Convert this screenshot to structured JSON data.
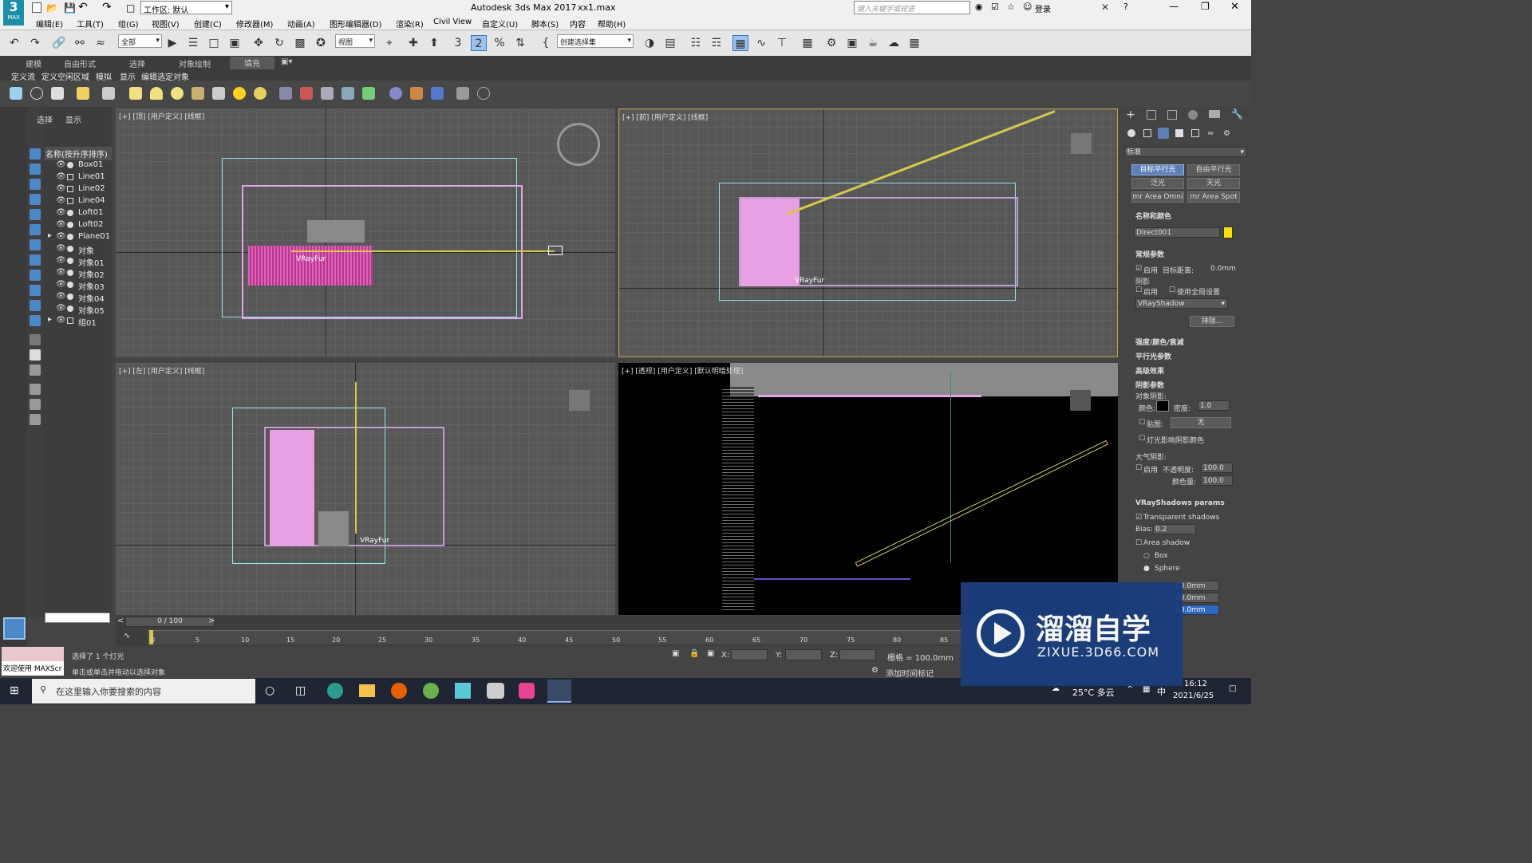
{
  "app": {
    "logo_text": "MAX",
    "logo_num": "3",
    "title": "Autodesk 3ds Max 2017",
    "file": "xx1.max",
    "workspace": "工作区: 默认",
    "search_placeholder": "键入关键字或短语",
    "login": "登录"
  },
  "menu": [
    "编辑(E)",
    "工具(T)",
    "组(G)",
    "视图(V)",
    "创建(C)",
    "修改器(M)",
    "动画(A)",
    "图形编辑器(D)",
    "渲染(R)",
    "Civil View",
    "自定义(U)",
    "脚本(S)",
    "内容",
    "帮助(H)"
  ],
  "toolbar": {
    "filter": "全部",
    "view": "视图",
    "selset": "创建选择集",
    "num3": "3",
    "num2": "2"
  },
  "ribbon_tabs": [
    "建模",
    "自由形式",
    "选择",
    "对象绘制",
    "填充"
  ],
  "ribbon_sub": [
    "定义流",
    "定义空闲区域",
    "模拟",
    "显示",
    "编辑选定对象"
  ],
  "scene_explorer": {
    "tabs": [
      "选择",
      "显示"
    ],
    "header": "名称(按升序排序)",
    "items": [
      "Box01",
      "Line01",
      "Line02",
      "Line04",
      "Loft01",
      "Loft02",
      "Plane01",
      "对象",
      "对象01",
      "对象02",
      "对象03",
      "对象04",
      "对象05",
      "组01"
    ]
  },
  "viewports": [
    {
      "label": "[+] [顶] [用户定义] [线框]",
      "tag": "VRayFur"
    },
    {
      "label": "[+] [前] [用户定义] [线框]",
      "tag": "VRayFur"
    },
    {
      "label": "[+] [左] [用户定义] [线框]",
      "tag": "VRayFur"
    },
    {
      "label": "[+] [透视] [用户定义] [默认明暗处理]",
      "tag": ""
    }
  ],
  "command_panel": {
    "category": "标准",
    "buttons": [
      "目标平行光",
      "自由平行光",
      "泛光",
      "天光",
      "mr Area Omni",
      "mr Area Spot"
    ],
    "name_color_head": "名称和颜色",
    "name_value": "Direct001",
    "light_color": "#ffe000",
    "general_head": "常规参数",
    "enable": "启用",
    "target_dist_label": "目标距离:",
    "target_dist": "0.0mm",
    "shadow_label": "阴影",
    "shadow_enable": "启用",
    "use_global": "使用全局设置",
    "shadow_type": "VRayShadow",
    "exclude": "排除...",
    "intensity_head": "强度/颜色/衰减",
    "dirlight_head": "平行光参数",
    "advanced_head": "高级效果",
    "shadowparams_head": "阴影参数",
    "object_shadow": "对象阴影:",
    "color_label": "颜色:",
    "density_label": "密度:",
    "density": "1.0",
    "map_label": "贴图:",
    "map_value": "无",
    "light_affect": "灯光影响阴影颜色",
    "atmo": "大气阴影:",
    "atmo_enable": "启用",
    "opacity_label": "不透明度:",
    "opacity": "100.0",
    "color_amount_label": "颜色量:",
    "color_amount": "100.0",
    "vray_head": "VRayShadows params",
    "transparent": "Transparent shadows",
    "bias_label": "Bias:",
    "bias": "0.2",
    "area_shadow": "Area shadow",
    "box": "Box",
    "sphere": "Sphere",
    "u": "50.0mm",
    "v": "50.0mm",
    "w": "50.0mm"
  },
  "timeline": {
    "frame": "0 / 100",
    "ticks": [
      "0",
      "5",
      "10",
      "15",
      "20",
      "25",
      "30",
      "35",
      "40",
      "45",
      "50",
      "55",
      "60",
      "65",
      "70",
      "75",
      "80",
      "85"
    ]
  },
  "status": {
    "welcome": "欢迎使用 MAXScr",
    "selected": "选择了 1 个灯光",
    "hint": "单击或单击并拖动以选择对象",
    "x_label": "X:",
    "y_label": "Y:",
    "z_label": "Z:",
    "grid": "栅格 = 100.0mm",
    "add_tag": "添加时间标记"
  },
  "taskbar": {
    "search": "在这里输入你要搜索的内容",
    "weather": "25°C 多云",
    "ime": "中",
    "time": "16:12",
    "date": "2021/6/25"
  },
  "watermark": {
    "title": "溜溜自学",
    "url": "ZIXUE.3D66.COM"
  }
}
